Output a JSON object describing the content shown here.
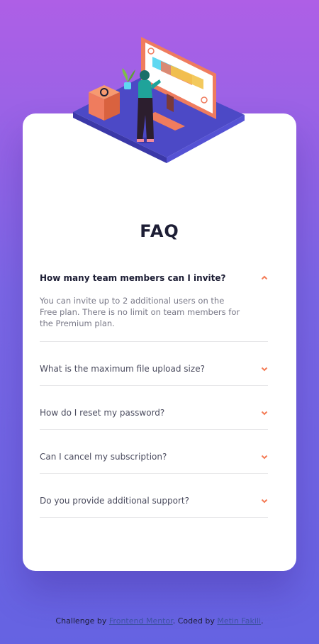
{
  "colors": {
    "accent": "#f47c57",
    "text_dark": "#1d1e35",
    "text_muted": "#787887",
    "divider": "#e7e7e9",
    "bg_top": "#ae5fe6",
    "bg_bottom": "#6563e2"
  },
  "illustration": {
    "name": "woman-at-monitor-illustration",
    "decor": "box-icon"
  },
  "faq": {
    "title": "FAQ",
    "items": [
      {
        "question": "How many team members can I invite?",
        "answer": "You can invite up to 2 additional users on the Free plan. There is no limit on team members for the Premium plan.",
        "open": true,
        "icon": "chevron-up-icon"
      },
      {
        "question": "What is the maximum file upload size?",
        "open": false,
        "icon": "chevron-down-icon"
      },
      {
        "question": "How do I reset my password?",
        "open": false,
        "icon": "chevron-down-icon"
      },
      {
        "question": "Can I cancel my subscription?",
        "open": false,
        "icon": "chevron-down-icon"
      },
      {
        "question": "Do you provide additional support?",
        "open": false,
        "icon": "chevron-down-icon"
      }
    ]
  },
  "footer": {
    "prefix": "Challenge by ",
    "link1": "Frontend Mentor",
    "middle": ". Coded by ",
    "link2": "Metin Fakili",
    "suffix": "."
  }
}
